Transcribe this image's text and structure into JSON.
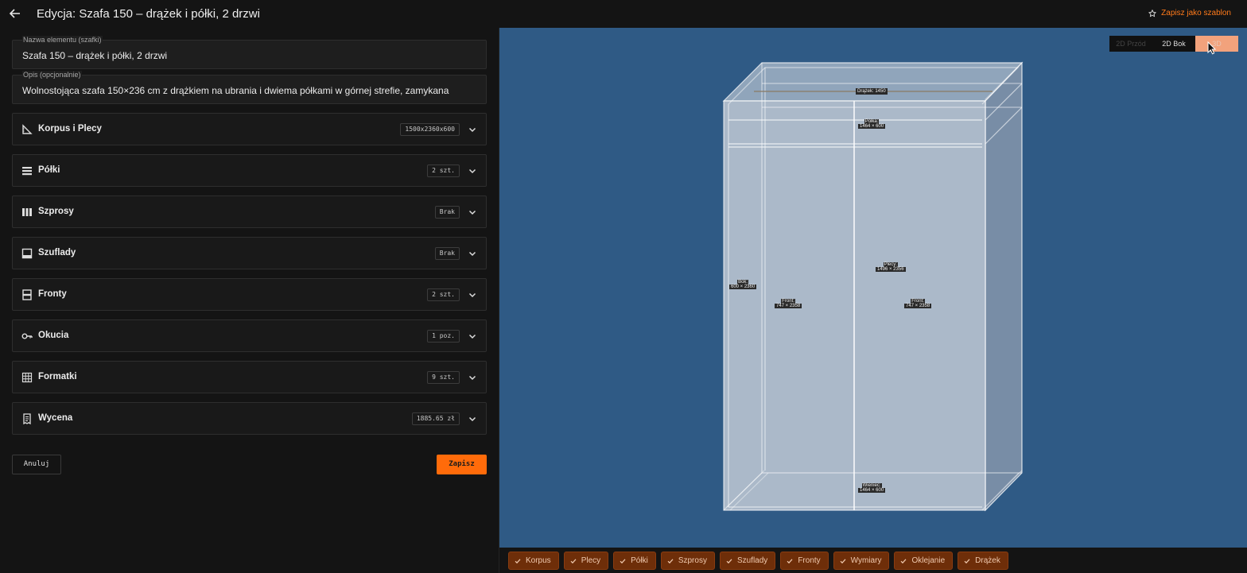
{
  "header": {
    "title": "Edycja: Szafa 150 – drążek i półki, 2 drzwi",
    "save_template_label": "Zapisz jako szablon"
  },
  "form": {
    "name_label": "Nazwa elementu (szafki)",
    "name_value": "Szafa 150 – drążek i półki, 2 drzwi",
    "desc_label": "Opis (opcjonalnie)",
    "desc_value": "Wolnostojąca szafa 150×236 cm z drążkiem na ubrania i dwiema półkami w górnej strefie, zamykana"
  },
  "sections": [
    {
      "name": "Korpus i Plecy",
      "badge": "1500x2360x600",
      "icon": "ruler-triangle-icon"
    },
    {
      "name": "Półki",
      "badge": "2 szt.",
      "icon": "shelves-icon"
    },
    {
      "name": "Szprosy",
      "badge": "Brak",
      "icon": "columns-icon"
    },
    {
      "name": "Szuflady",
      "badge": "Brak",
      "icon": "drawer-icon"
    },
    {
      "name": "Fronty",
      "badge": "2 szt.",
      "icon": "fronts-icon"
    },
    {
      "name": "Okucia",
      "badge": "1 poz.",
      "icon": "key-icon"
    },
    {
      "name": "Formatki",
      "badge": "9 szt.",
      "icon": "grid-icon"
    },
    {
      "name": "Wycena",
      "badge": "1885.65 zł",
      "icon": "receipt-icon"
    }
  ],
  "actions": {
    "cancel": "Anuluj",
    "save": "Zapisz"
  },
  "view_tabs": {
    "front": "2D Przód",
    "side": "2D Bok",
    "three_d": "3D"
  },
  "viewport_labels": {
    "rod": "Drążek: 1450",
    "shelf_name": "Półka:",
    "shelf_dim": "1464 × 600",
    "back_name": "Plecy:",
    "back_dim": "1496 × 2356",
    "side_name": "Bok:",
    "side_dim": "600 × 2360",
    "front_left_name": "Front:",
    "front_left_dim": "747 × 2358",
    "front_right_name": "Front:",
    "front_right_dim": "747 × 2358",
    "crown_name": "Wieniec:",
    "crown_dim": "1464 × 600"
  },
  "chips": [
    "Korpus",
    "Plecy",
    "Półki",
    "Szprosy",
    "Szuflady",
    "Fronty",
    "Wymiary",
    "Oklejanie",
    "Drążek"
  ],
  "colors": {
    "accent": "#ff6b0a",
    "viewport_bg": "#2f5a85",
    "chip_bg": "#6e2e09"
  }
}
